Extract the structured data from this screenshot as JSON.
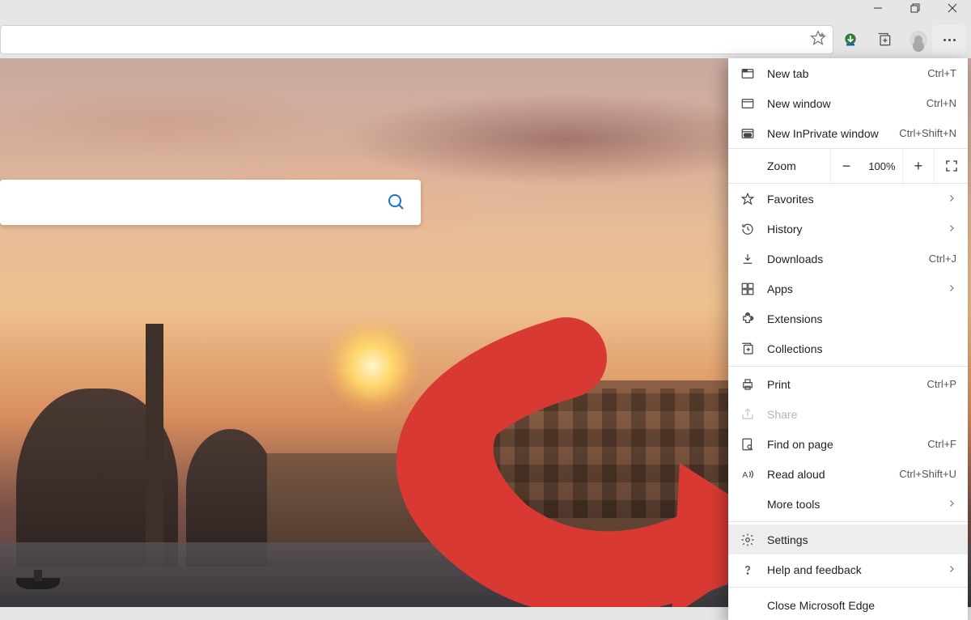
{
  "window_controls": {
    "minimize": "minimize",
    "maximize": "restore",
    "close": "close"
  },
  "toolbar": {
    "favorite_icon": "star-add",
    "ext_icon": "download-manager",
    "collections_icon": "collections",
    "profile_icon": "profile",
    "more_icon": "more"
  },
  "menu": {
    "new_tab": {
      "label": "New tab",
      "shortcut": "Ctrl+T"
    },
    "new_window": {
      "label": "New window",
      "shortcut": "Ctrl+N"
    },
    "new_inprivate": {
      "label": "New InPrivate window",
      "shortcut": "Ctrl+Shift+N"
    },
    "zoom": {
      "label": "Zoom",
      "value": "100%"
    },
    "favorites": {
      "label": "Favorites"
    },
    "history": {
      "label": "History"
    },
    "downloads": {
      "label": "Downloads",
      "shortcut": "Ctrl+J"
    },
    "apps": {
      "label": "Apps"
    },
    "extensions": {
      "label": "Extensions"
    },
    "collections": {
      "label": "Collections"
    },
    "print": {
      "label": "Print",
      "shortcut": "Ctrl+P"
    },
    "share": {
      "label": "Share"
    },
    "find": {
      "label": "Find on page",
      "shortcut": "Ctrl+F"
    },
    "read_aloud": {
      "label": "Read aloud",
      "shortcut": "Ctrl+Shift+U"
    },
    "more_tools": {
      "label": "More tools"
    },
    "settings": {
      "label": "Settings"
    },
    "help": {
      "label": "Help and feedback"
    },
    "close_edge": {
      "label": "Close Microsoft Edge"
    }
  },
  "annotation": {
    "target": "settings"
  }
}
